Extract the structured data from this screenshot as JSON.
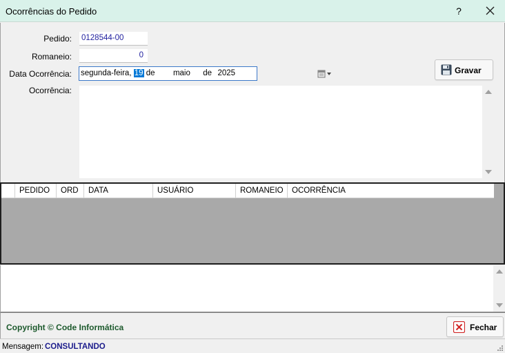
{
  "window": {
    "title": "Ocorrências do Pedido",
    "help_label": "?"
  },
  "form": {
    "pedido_label": "Pedido:",
    "pedido_value": "0128544-00",
    "romaneio_label": "Romaneio:",
    "romaneio_value": "0",
    "data_label": "Data Ocorrência:",
    "data_weekday": "segunda-feira,",
    "data_day": "19",
    "data_de1": "de",
    "data_month": "maio",
    "data_de2": "de",
    "data_year": "2025",
    "ocorrencia_label": "Ocorrência:",
    "ocorrencia_value": ""
  },
  "toolbar": {
    "save_label": "Gravar",
    "close_label": "Fechar"
  },
  "grid": {
    "columns": [
      "PEDIDO",
      "ORD",
      "DATA",
      "USUÁRIO",
      "ROMANEIO",
      "OCORRÊNCIA"
    ],
    "rows": []
  },
  "footer": {
    "copyright": "Copyright © Code Informática"
  },
  "status": {
    "label": "Mensagem:",
    "value": "CONSULTANDO"
  },
  "colors": {
    "titlebar": "#d9f2ea",
    "value_text": "#1f1f9e",
    "copyright": "#1d5a2d",
    "grid_bg": "#a9a9a9",
    "selection": "#0078d7"
  }
}
